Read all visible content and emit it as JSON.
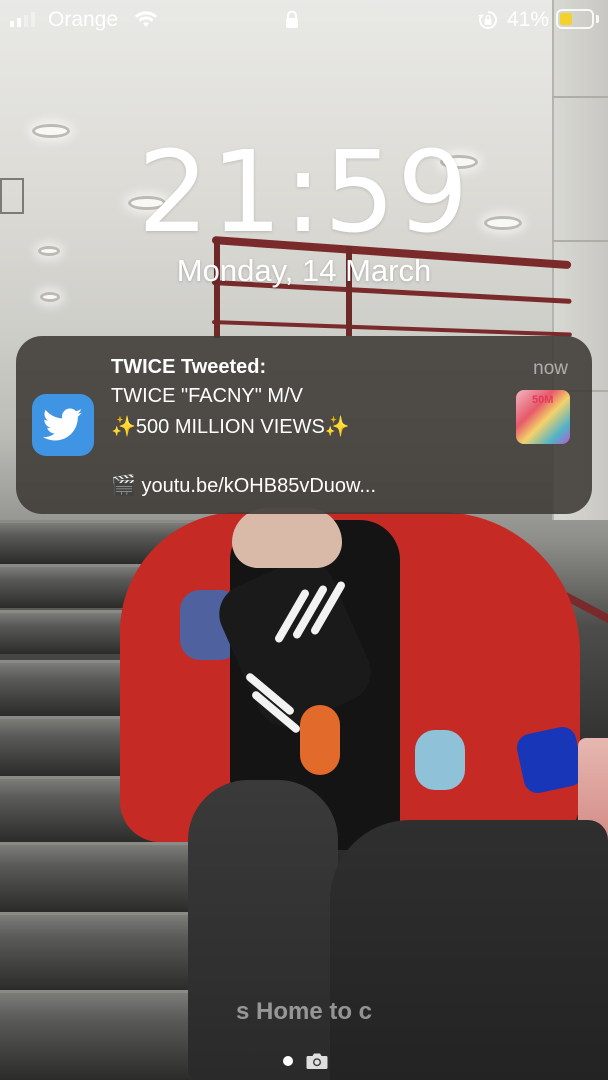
{
  "status_bar": {
    "carrier": "Orange",
    "battery_percent": "41%",
    "battery_level": 0.41,
    "battery_color": "#f4d22c",
    "icons": [
      "signal-icon",
      "wifi-icon",
      "lock-icon",
      "rotation-lock-icon",
      "battery-icon"
    ]
  },
  "lock_screen": {
    "time": "21:59",
    "date": "Monday, 14 March",
    "home_hint": "s Home to c"
  },
  "notification": {
    "app_icon": "twitter-bird-icon",
    "app_color": "#3f95e3",
    "title": "TWICE Tweeted:",
    "time": "now",
    "line1": "TWICE \"FACNY\" M/V",
    "line2": "✨500 MILLION VIEWS✨",
    "line3": "🎬 youtu.be/kOHB85vDuow...",
    "thumbnail_text": "50M"
  },
  "bottom": {
    "icons": [
      "page-indicator-dot",
      "camera-icon"
    ]
  }
}
